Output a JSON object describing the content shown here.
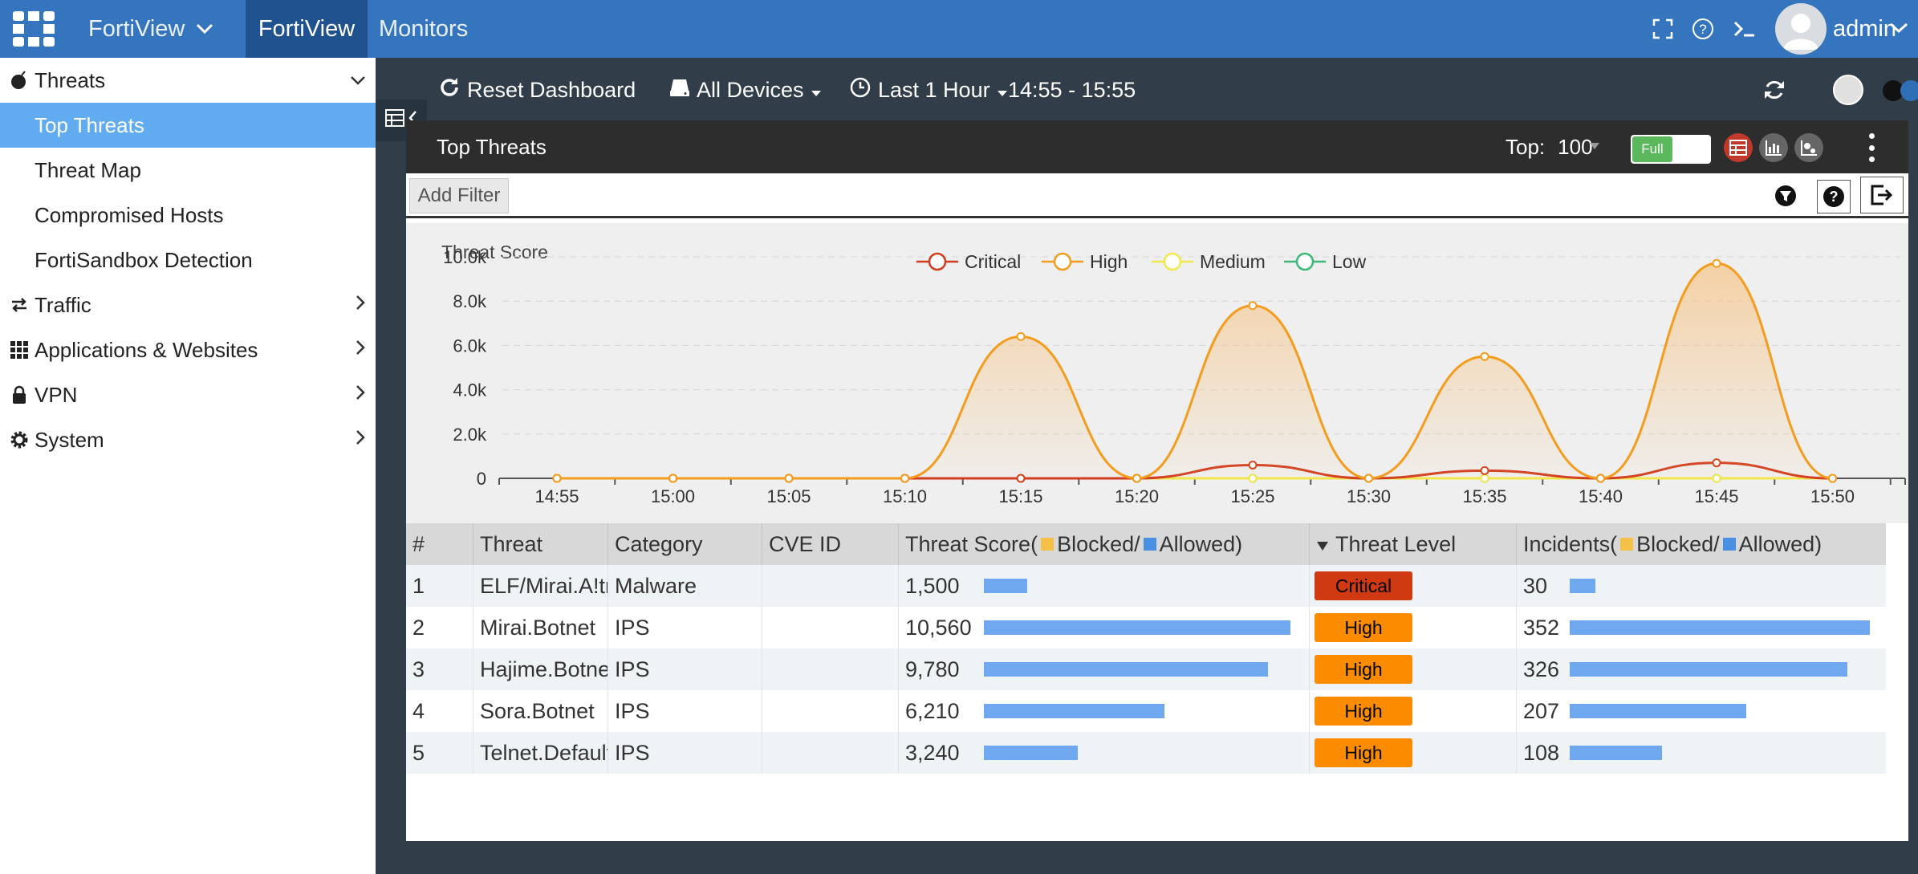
{
  "topbar": {
    "menu_label": "FortiView",
    "active_tab": "FortiView",
    "monitors_tab": "Monitors",
    "username": "admin"
  },
  "sidebar": {
    "items": [
      {
        "label": "Threats",
        "icon": "bomb-icon",
        "expanded": true
      },
      {
        "label": "Top Threats",
        "active": true
      },
      {
        "label": "Threat Map"
      },
      {
        "label": "Compromised Hosts"
      },
      {
        "label": "FortiSandbox Detection"
      },
      {
        "label": "Traffic",
        "icon": "arrows-exchange-icon"
      },
      {
        "label": "Applications & Websites",
        "icon": "grid-icon"
      },
      {
        "label": "VPN",
        "icon": "lock-icon"
      },
      {
        "label": "System",
        "icon": "gear-icon"
      }
    ]
  },
  "toolbar": {
    "reset_label": "Reset Dashboard",
    "devices_label": "All Devices",
    "time_label": "Last 1 Hour",
    "time_range": "14:55 - 15:55"
  },
  "widget": {
    "title": "Top Threats",
    "top_label": "Top:",
    "top_value": "100",
    "toggle_label": "Full",
    "add_filter": "Add Filter"
  },
  "chart_data": {
    "type": "line",
    "title": "Threat Score",
    "x": [
      "14:55",
      "15:00",
      "15:05",
      "15:10",
      "15:15",
      "15:20",
      "15:25",
      "15:30",
      "15:35",
      "15:40",
      "15:45",
      "15:50"
    ],
    "y_ticks": [
      "0",
      "2.0k",
      "4.0k",
      "6.0k",
      "8.0k",
      "10.0k"
    ],
    "ylim": [
      0,
      10000
    ],
    "series": [
      {
        "name": "Critical",
        "color": "#d13b1e",
        "values": [
          0,
          0,
          0,
          0,
          0,
          0,
          600,
          0,
          350,
          0,
          700,
          0
        ]
      },
      {
        "name": "High",
        "color": "#f39c1d",
        "values": [
          0,
          0,
          0,
          0,
          6400,
          0,
          7800,
          0,
          5500,
          0,
          9700,
          0
        ]
      },
      {
        "name": "Medium",
        "color": "#f2e84c",
        "values": [
          0,
          0,
          0,
          0,
          0,
          0,
          0,
          0,
          0,
          0,
          0,
          0
        ]
      },
      {
        "name": "Low",
        "color": "#3cb878",
        "values": [
          0,
          0,
          0,
          0,
          0,
          0,
          0,
          0,
          0,
          0,
          0,
          0
        ]
      }
    ],
    "legend_position": "top"
  },
  "table": {
    "headers": {
      "num": "#",
      "threat": "Threat",
      "category": "Category",
      "cve": "CVE ID",
      "score_prefix": "Threat Score(",
      "score_blocked": "Blocked/",
      "score_allowed": "Allowed)",
      "level": "Threat Level",
      "inc_prefix": "Incidents(",
      "inc_blocked": "Blocked/",
      "inc_allowed": "Allowed)"
    },
    "rows": [
      {
        "num": "1",
        "threat": "ELF/Mirai.A!tr",
        "category": "Malware",
        "cve": "",
        "score": "1,500",
        "score_frac": 0.142,
        "level": "Critical",
        "level_color": "#d03a12",
        "incidents": "30",
        "inc_frac": 0.085
      },
      {
        "num": "2",
        "threat": "Mirai.Botnet",
        "category": "IPS",
        "cve": "",
        "score": "10,560",
        "score_frac": 1.0,
        "level": "High",
        "level_color": "#fb8c00",
        "incidents": "352",
        "inc_frac": 1.0
      },
      {
        "num": "3",
        "threat": "Hajime.Botnet",
        "category": "IPS",
        "cve": "",
        "score": "9,780",
        "score_frac": 0.926,
        "level": "High",
        "level_color": "#fb8c00",
        "incidents": "326",
        "inc_frac": 0.926
      },
      {
        "num": "4",
        "threat": "Sora.Botnet",
        "category": "IPS",
        "cve": "",
        "score": "6,210",
        "score_frac": 0.588,
        "level": "High",
        "level_color": "#fb8c00",
        "incidents": "207",
        "inc_frac": 0.588
      },
      {
        "num": "5",
        "threat": "Telnet.Default",
        "category": "IPS",
        "cve": "",
        "score": "3,240",
        "score_frac": 0.307,
        "level": "High",
        "level_color": "#fb8c00",
        "incidents": "108",
        "inc_frac": 0.307
      }
    ],
    "blocked_color": "#f5c048",
    "allowed_color": "#4a90e2"
  }
}
